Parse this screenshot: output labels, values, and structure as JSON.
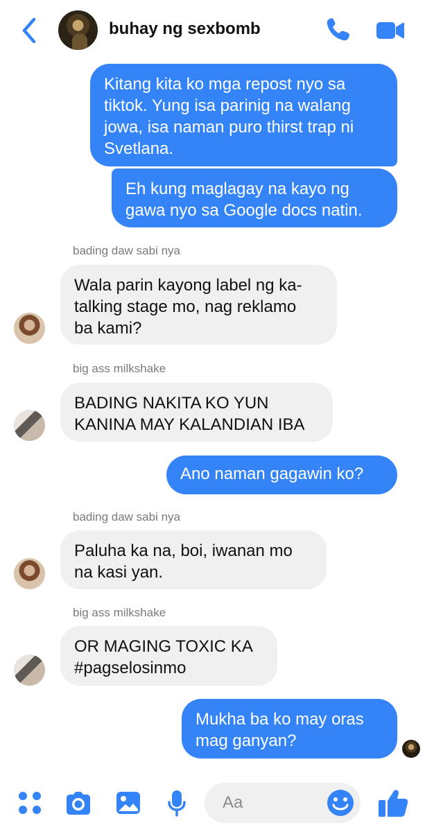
{
  "header": {
    "title": "buhay ng sexbomb",
    "back_icon": "chevron-left-icon",
    "call_icon": "phone-icon",
    "video_icon": "video-camera-icon",
    "accent": "#3584f7"
  },
  "messages": [
    {
      "type": "outgoing",
      "text": "Kitang kita ko mga repost nyo sa\ntiktok. Yung isa parinig na walang\njowa, isa naman puro thirst trap ni\nSvetlana."
    },
    {
      "type": "outgoing",
      "text": "Eh kung maglagay na kayo ng\ngawa nyo sa Google docs natin."
    },
    {
      "type": "incoming",
      "sender": "bading daw sabi nya",
      "text": "Wala parin kayong label ng ka-\ntalking stage mo, nag reklamo\nba kami?"
    },
    {
      "type": "incoming",
      "sender": "big ass milkshake",
      "text": "BADING NAKITA KO YUN\nKANINA MAY KALANDIAN IBA"
    },
    {
      "type": "outgoing",
      "text": "Ano naman gagawin ko?"
    },
    {
      "type": "incoming",
      "sender": "bading daw sabi nya",
      "text": "Paluha ka na, boi, iwanan mo\nna kasi yan."
    },
    {
      "type": "incoming",
      "sender": "big ass milkshake",
      "text": "OR MAGING TOXIC KA\n#pagselosinmo"
    },
    {
      "type": "outgoing",
      "text": "Mukha ba ko may oras\nmag ganyan?"
    }
  ],
  "composer": {
    "placeholder": "Aa",
    "icons": [
      "apps-icon",
      "camera-icon",
      "image-icon",
      "microphone-icon",
      "emoji-icon",
      "thumbs-up-icon"
    ]
  }
}
